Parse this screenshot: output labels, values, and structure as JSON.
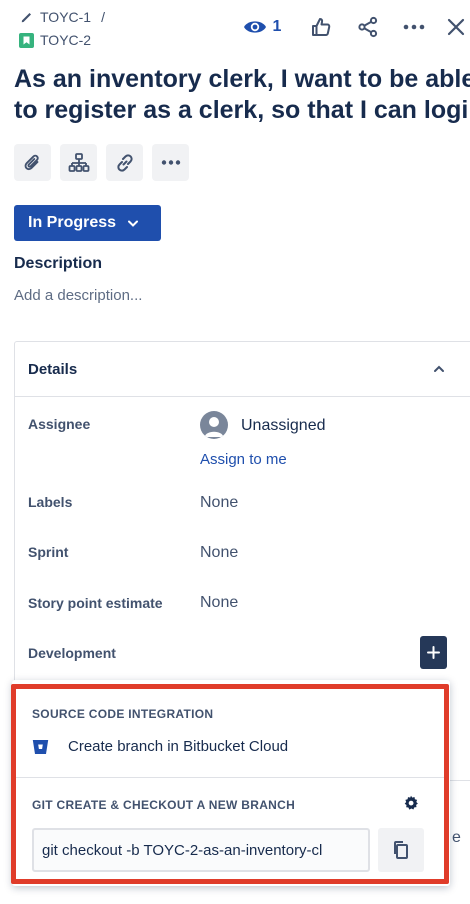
{
  "breadcrumb": {
    "parent_key": "TOYC-1",
    "separator": "/",
    "issue_key": "TOYC-2"
  },
  "header": {
    "watchers_count": "1",
    "icons": [
      "eye-icon",
      "thumbs-up-icon",
      "share-icon",
      "more-icon",
      "close-icon"
    ]
  },
  "issue": {
    "title_line1": "As an inventory clerk, I want to be able",
    "title_line2": "to register as a clerk, so that I can login"
  },
  "toolbar": {
    "icons": [
      "attachment-icon",
      "child-issue-icon",
      "link-icon",
      "more-icon"
    ]
  },
  "status": {
    "label": "In Progress"
  },
  "description": {
    "label": "Description",
    "placeholder": "Add a description..."
  },
  "details": {
    "title": "Details",
    "fields": {
      "assignee_label": "Assignee",
      "assignee_value": "Unassigned",
      "assign_to_me": "Assign to me",
      "labels_label": "Labels",
      "labels_value": "None",
      "sprint_label": "Sprint",
      "sprint_value": "None",
      "story_points_label": "Story point estimate",
      "story_points_value": "None",
      "development_label": "Development"
    }
  },
  "popup": {
    "source_section_title": "SOURCE CODE INTEGRATION",
    "bitbucket_action": "Create branch in Bitbucket Cloud",
    "git_section_title": "GIT CREATE & CHECKOUT A NEW BRANCH",
    "git_command": "git checkout -b TOYC-2-as-an-inventory-cl"
  },
  "colors": {
    "primary": "#1f4fad",
    "highlight": "#e03c2a",
    "story_green": "#36b37e",
    "text": "#172b4d"
  }
}
